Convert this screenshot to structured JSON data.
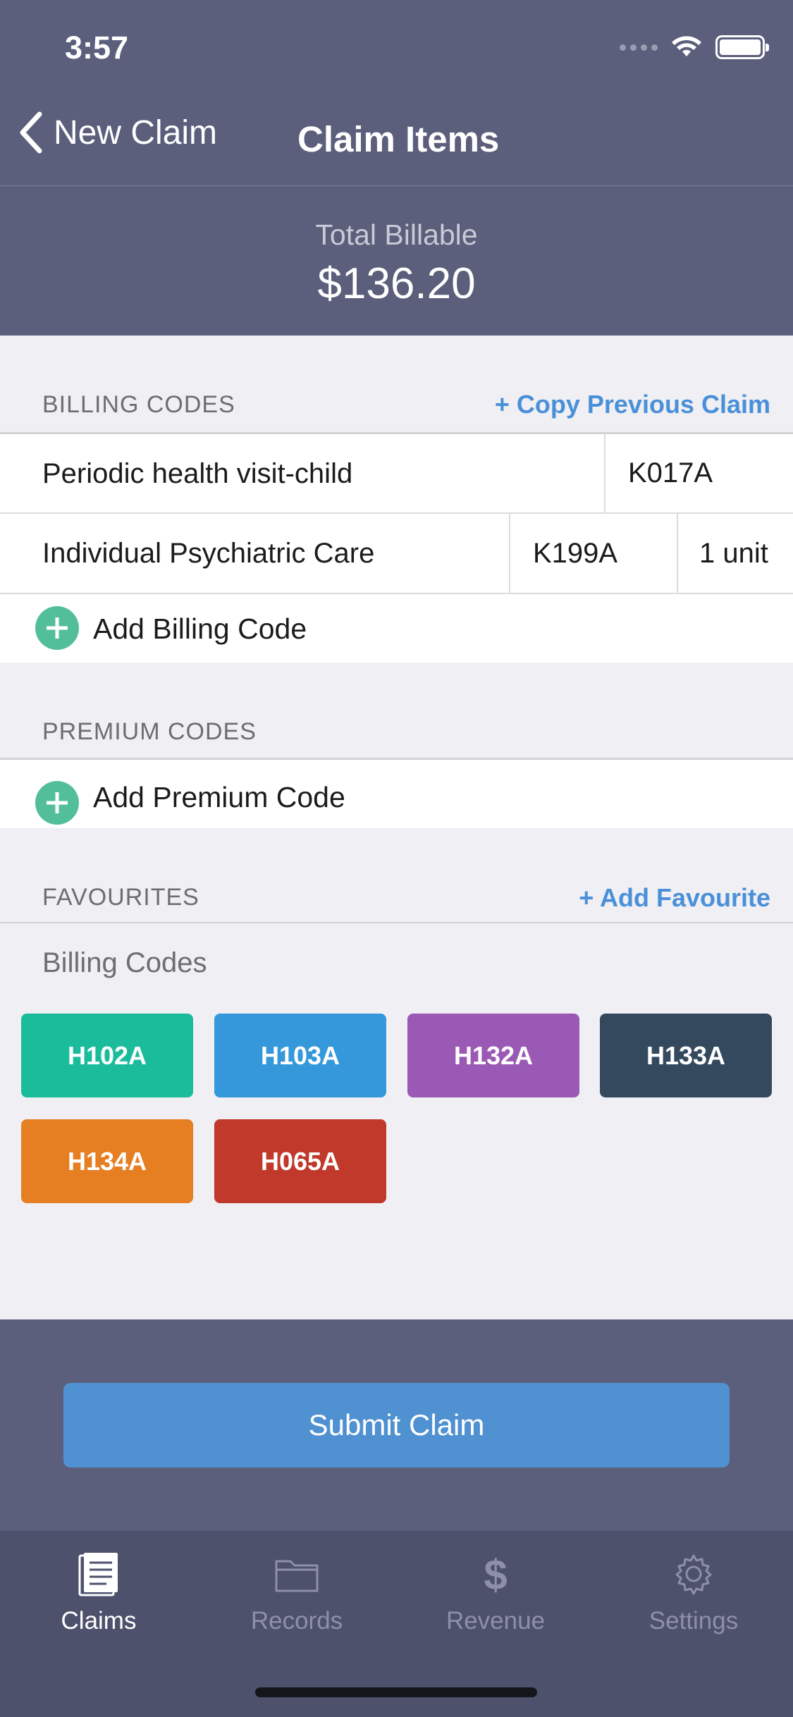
{
  "status_bar": {
    "time": "3:57"
  },
  "nav": {
    "back_label": "New Claim",
    "title": "Claim Items"
  },
  "total": {
    "label": "Total Billable",
    "value": "$136.20"
  },
  "billing": {
    "section_label": "BILLING CODES",
    "copy_link": "+ Copy Previous Claim",
    "rows": [
      {
        "description": "Periodic health visit-child",
        "code": "K017A"
      },
      {
        "description": "Individual Psychiatric Care",
        "code": "K199A",
        "units": "1 unit"
      }
    ],
    "add_label": "Add Billing Code"
  },
  "premium": {
    "section_label": "PREMIUM CODES",
    "add_label": "Add Premium Code"
  },
  "favourites": {
    "section_label": "FAVOURITES",
    "add_link": "+ Add Favourite",
    "subtitle": "Billing Codes",
    "chips": [
      {
        "label": "H102A",
        "color": "#1abc9c"
      },
      {
        "label": "H103A",
        "color": "#3498db"
      },
      {
        "label": "H132A",
        "color": "#9b59b6"
      },
      {
        "label": "H133A",
        "color": "#34495e"
      },
      {
        "label": "H134A",
        "color": "#e67e22"
      },
      {
        "label": "H065A",
        "color": "#c0392b"
      }
    ]
  },
  "submit_label": "Submit Claim",
  "tabs": [
    {
      "label": "Claims",
      "icon": "document-icon",
      "active": true
    },
    {
      "label": "Records",
      "icon": "folder-icon",
      "active": false
    },
    {
      "label": "Revenue",
      "icon": "dollar-icon",
      "active": false
    },
    {
      "label": "Settings",
      "icon": "gear-icon",
      "active": false
    }
  ],
  "colors": {
    "header": "#5b5f7b",
    "accent": "#4a90d9",
    "add": "#52bf9a"
  }
}
